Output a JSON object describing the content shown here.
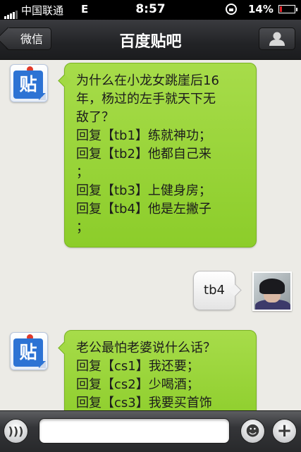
{
  "status_bar": {
    "carrier": "中国联通",
    "network": "E",
    "time": "8:57",
    "battery": "14%"
  },
  "nav": {
    "back_label": "微信",
    "title": "百度贴吧",
    "profile_icon": "person-icon"
  },
  "chat": {
    "messages": [
      {
        "from": "tieba",
        "avatar_text": "贴",
        "lines": [
          "为什么在小龙女跳崖后16",
          "年，杨过的左手就天下无",
          "敌了？",
          "回复【tb1】练就神功；",
          "回复【tb2】他都自己来",
          "；",
          "回复【tb3】上健身房；",
          "回复【tb4】他是左撇子",
          "；"
        ]
      },
      {
        "from": "me",
        "text": "tb4"
      },
      {
        "from": "tieba",
        "avatar_text": "贴",
        "lines": [
          "老公最怕老婆说什么话？",
          "回复【cs1】我还要；",
          "回复【cs2】少喝酒；",
          "回复【cs3】我要买首饰"
        ]
      }
    ]
  },
  "input_bar": {
    "voice_icon": "voice-icon",
    "voice_glyph": ")))",
    "emoji_icon": "emoji-icon",
    "emoji_glyph": "☻",
    "plus_icon": "plus-icon",
    "plus_glyph": "+",
    "input_value": ""
  },
  "colors": {
    "incoming_bubble": "#9ad63a",
    "nav_bar": "#2a2b2e",
    "chat_background": "#ecebe6"
  }
}
